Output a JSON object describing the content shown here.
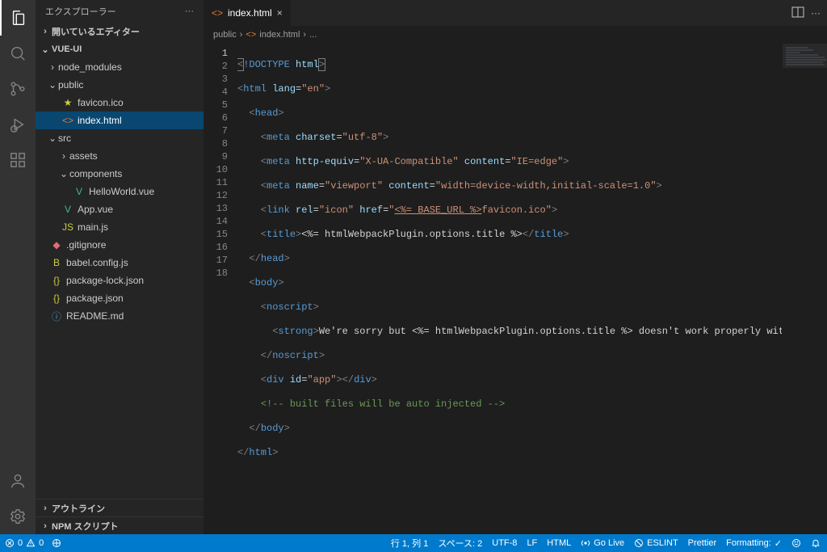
{
  "sidebar": {
    "title": "エクスプローラー",
    "openEditors": "開いているエディター",
    "project": "VUE-UI",
    "outline": "アウトライン",
    "npm": "NPM スクリプト",
    "tree": {
      "node_modules": "node_modules",
      "public": "public",
      "favicon": "favicon.ico",
      "index": "index.html",
      "src": "src",
      "assets": "assets",
      "components": "components",
      "hello": "HelloWorld.vue",
      "appvue": "App.vue",
      "mainjs": "main.js",
      "gitignore": ".gitignore",
      "babel": "babel.config.js",
      "pkglock": "package-lock.json",
      "pkg": "package.json",
      "readme": "README.md"
    }
  },
  "tab": {
    "file": "index.html"
  },
  "breadcrumb": {
    "a": "public",
    "b": "index.html",
    "c": "..."
  },
  "code": {
    "l1a": "<",
    "l1b": "!DOCTYPE",
    "l1c": " html",
    "l1d": ">",
    "l2a": "<",
    "l2b": "html",
    "l2c": " lang",
    "l2d": "=",
    "l2e": "\"en\"",
    "l2f": ">",
    "l3a": "  <",
    "l3b": "head",
    "l3c": ">",
    "l4a": "    <",
    "l4b": "meta",
    "l4c": " charset",
    "l4d": "=",
    "l4e": "\"utf-8\"",
    "l4f": ">",
    "l5a": "    <",
    "l5b": "meta",
    "l5c": " http-equiv",
    "l5d": "=",
    "l5e": "\"X-UA-Compatible\"",
    "l5f": " content",
    "l5g": "=",
    "l5h": "\"IE=edge\"",
    "l5i": ">",
    "l6a": "    <",
    "l6b": "meta",
    "l6c": " name",
    "l6d": "=",
    "l6e": "\"viewport\"",
    "l6f": " content",
    "l6g": "=",
    "l6h": "\"width=device-width,initial-scale=1.0\"",
    "l6i": ">",
    "l7a": "    <",
    "l7b": "link",
    "l7c": " rel",
    "l7d": "=",
    "l7e": "\"icon\"",
    "l7f": " href",
    "l7g": "=",
    "l7h": "\"",
    "l7url": "<%= BASE_URL %>",
    "l7i": "favicon.ico\"",
    "l7j": ">",
    "l8a": "    <",
    "l8b": "title",
    "l8c": ">",
    "l8d": "<%= htmlWebpackPlugin.options.title %>",
    "l8e": "</",
    "l8f": "title",
    "l8g": ">",
    "l9a": "  </",
    "l9b": "head",
    "l9c": ">",
    "l10a": "  <",
    "l10b": "body",
    "l10c": ">",
    "l11a": "    <",
    "l11b": "noscript",
    "l11c": ">",
    "l12a": "      <",
    "l12b": "strong",
    "l12c": ">",
    "l12d": "We're sorry but <%= htmlWebpackPlugin.options.title %> doesn't work properly without JavaScript enabled. Please e",
    "l13a": "    </",
    "l13b": "noscript",
    "l13c": ">",
    "l14a": "    <",
    "l14b": "div",
    "l14c": " id",
    "l14d": "=",
    "l14e": "\"app\"",
    "l14f": "></",
    "l14g": "div",
    "l14h": ">",
    "l15a": "    ",
    "l15b": "<!-- built files will be auto injected -->",
    "l16a": "  </",
    "l16b": "body",
    "l16c": ">",
    "l17a": "</",
    "l17b": "html",
    "l17c": ">"
  },
  "status": {
    "errors": "0",
    "warnings": "0",
    "line": "行 1, 列 1",
    "spaces": "スペース: 2",
    "encoding": "UTF-8",
    "eol": "LF",
    "lang": "HTML",
    "golive": "Go Live",
    "eslint": "ESLINT",
    "prettier": "Prettier",
    "formatting": "Formatting:",
    "check": "✓"
  }
}
